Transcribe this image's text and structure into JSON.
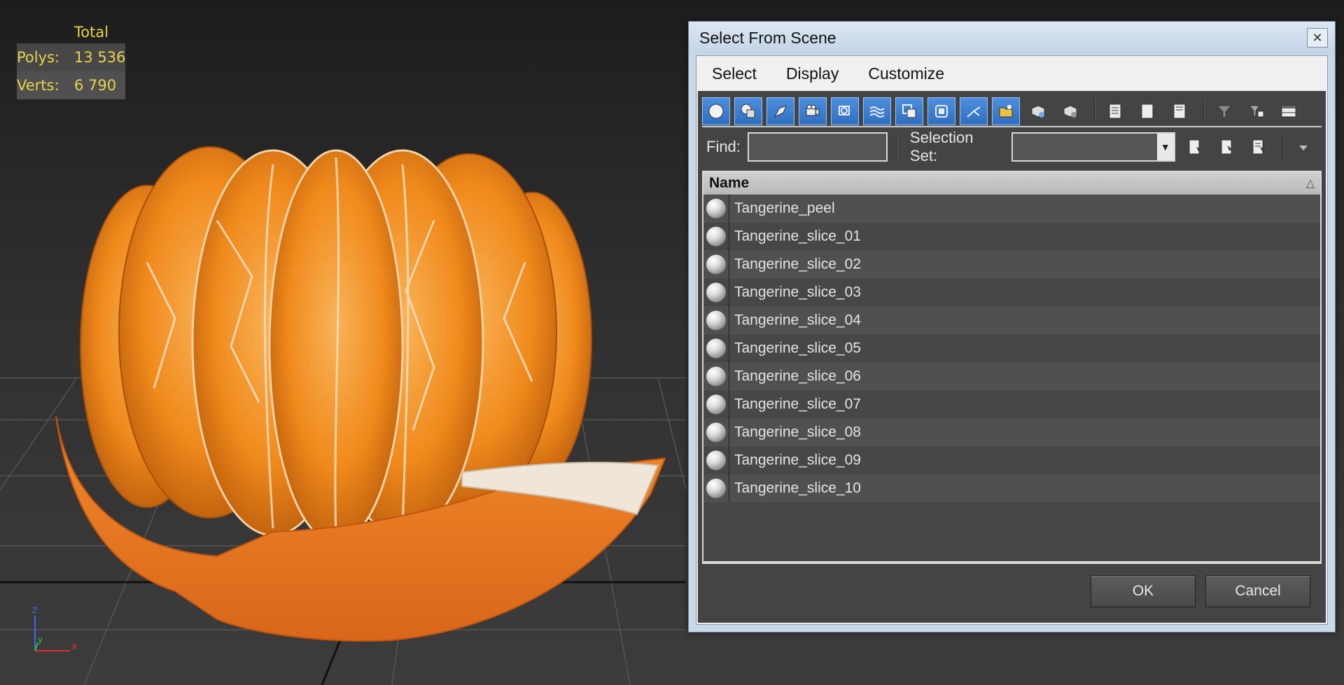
{
  "viewport": {
    "stats": {
      "column_header": "Total",
      "polys_label": "Polys:",
      "polys_value": "13 536",
      "verts_label": "Verts:",
      "verts_value": "6 790"
    },
    "axis": {
      "x": "x",
      "y": "y",
      "z": "z"
    }
  },
  "dialog": {
    "title": "Select From Scene",
    "close_glyph": "✕",
    "menu": [
      "Select",
      "Display",
      "Customize"
    ],
    "toolbar_icons": [
      "geometry-icon",
      "shapes-icon",
      "lights-icon",
      "cameras-icon",
      "helpers-icon",
      "spacewarps-icon",
      "groups-icon",
      "xrefs-icon",
      "bones-icon",
      "containers-icon",
      "frozen-icon",
      "hidden-icon",
      "list-all-icon",
      "list-none-icon",
      "list-invert-icon",
      "filter-icon",
      "filter-options-icon",
      "layout-icon"
    ],
    "find_label": "Find:",
    "find_value": "",
    "selection_set_label": "Selection Set:",
    "selection_set_value": "",
    "list_header": "Name",
    "sort_glyph": "△",
    "items": [
      "Tangerine_peel",
      "Tangerine_slice_01",
      "Tangerine_slice_02",
      "Tangerine_slice_03",
      "Tangerine_slice_04",
      "Tangerine_slice_05",
      "Tangerine_slice_06",
      "Tangerine_slice_07",
      "Tangerine_slice_08",
      "Tangerine_slice_09",
      "Tangerine_slice_10"
    ],
    "ok_label": "OK",
    "cancel_label": "Cancel"
  },
  "colors": {
    "stats_text": "#e8d24a",
    "tangerine": "#f08a1c",
    "toolbar_active": "#3a7ed3"
  }
}
